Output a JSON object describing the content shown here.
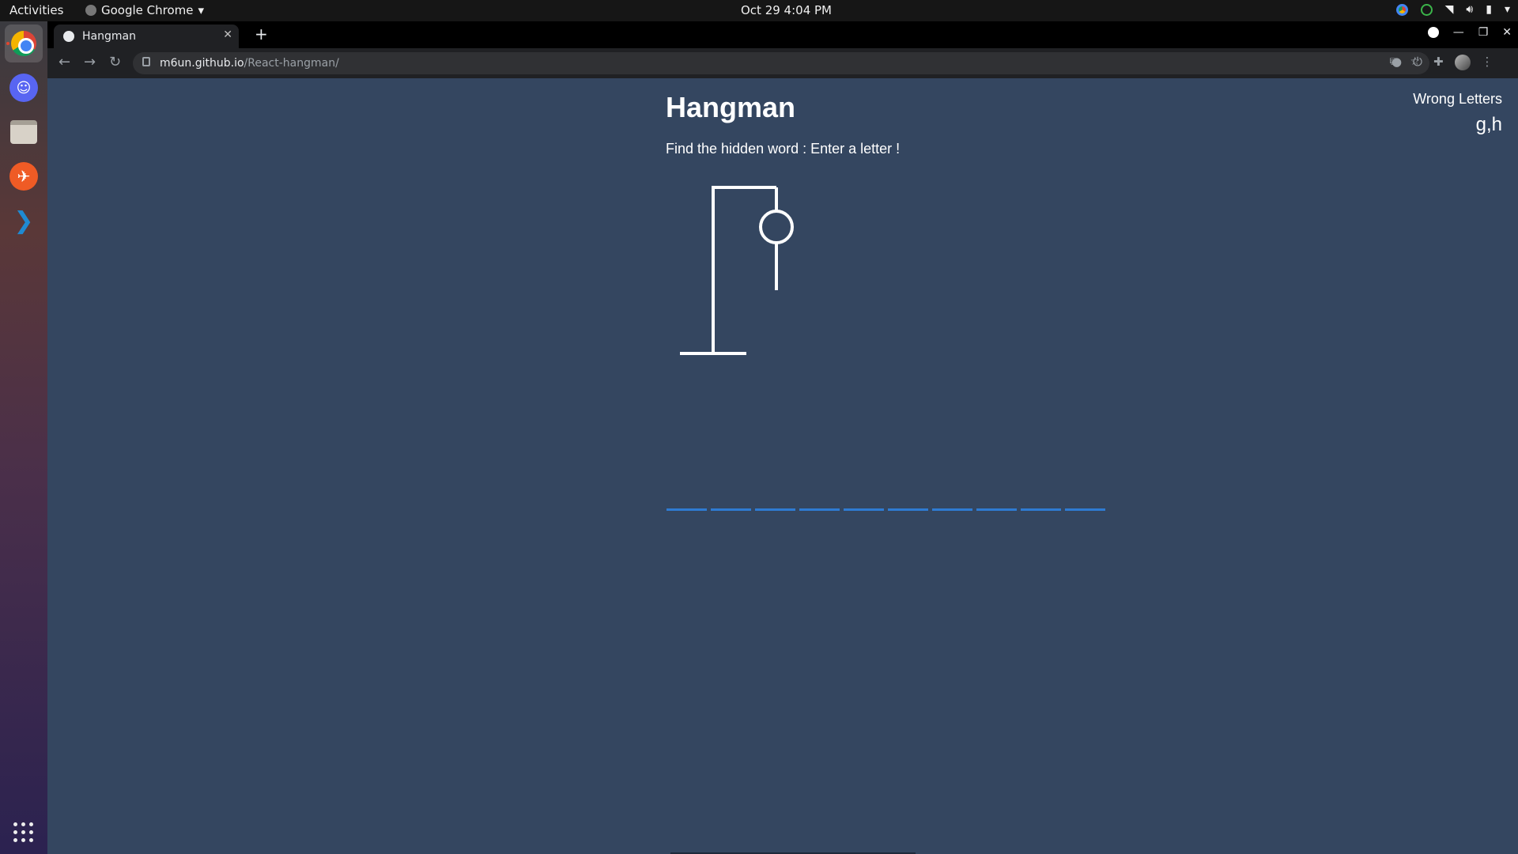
{
  "topbar": {
    "activities": "Activities",
    "app_name": "Google Chrome",
    "clock": "Oct 29  4:04 PM"
  },
  "dock": {
    "items": [
      "Google Chrome",
      "Discord",
      "Files",
      "Postman",
      "Visual Studio Code",
      "Show Applications"
    ]
  },
  "browser": {
    "tab_title": "Hangman",
    "url_host": "m6un.github.io",
    "url_path": "/React-hangman/"
  },
  "game": {
    "title": "Hangman",
    "subtitle": "Find the hidden word : Enter a letter !",
    "wrong_letters_label": "Wrong Letters",
    "wrong_letters": "g,h",
    "hidden_word_slots": [
      "",
      "",
      "",
      "",
      "",
      "",
      "",
      "",
      "",
      ""
    ],
    "figure_parts_drawn": [
      "gallows",
      "head",
      "body"
    ]
  }
}
